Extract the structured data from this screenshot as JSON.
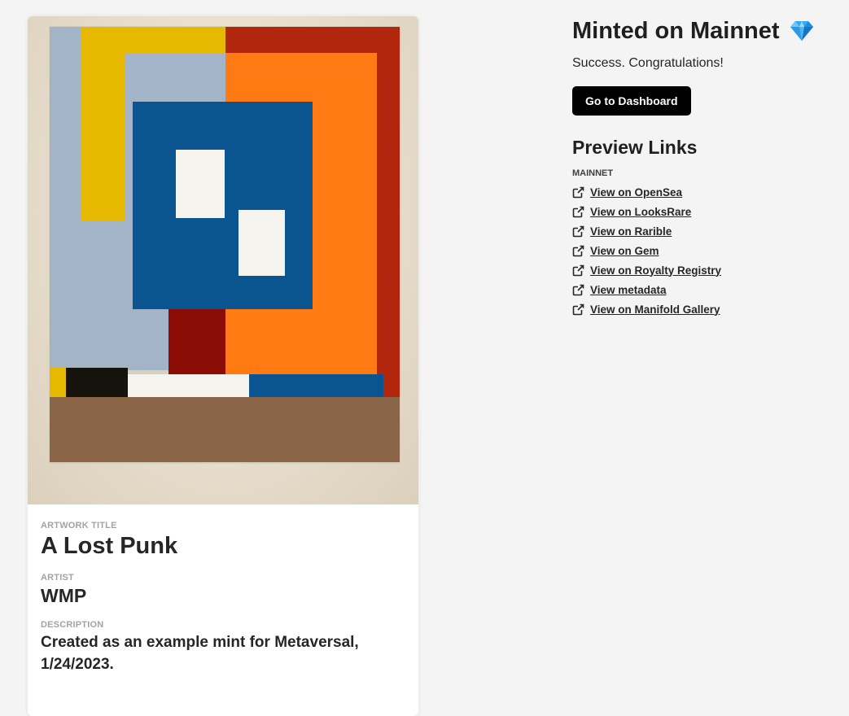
{
  "artwork": {
    "title_label": "ARTWORK TITLE",
    "title": "A Lost Punk",
    "artist_label": "ARTIST",
    "artist": "WMP",
    "description_label": "DESCRIPTION",
    "description": "Created as an example mint for Metaversal, 1/24/2023."
  },
  "status": {
    "title": "Minted on Mainnet",
    "title_icon": "diamond-icon",
    "message": "Success. Congratulations!",
    "dashboard_button": "Go to Dashboard"
  },
  "preview": {
    "title": "Preview Links",
    "network_label": "MAINNET",
    "link_icon": "external-link-icon",
    "links": [
      {
        "label": "View on OpenSea"
      },
      {
        "label": "View on LooksRare"
      },
      {
        "label": "View on Rarible"
      },
      {
        "label": "View on Gem"
      },
      {
        "label": "View on Royalty Registry"
      },
      {
        "label": "View metadata"
      },
      {
        "label": "View on Manifold Gallery"
      }
    ]
  },
  "colors": {
    "page_background": "#f4f4f4",
    "button_background": "#000000",
    "button_text": "#ffffff",
    "label_gray": "#a3a3a3",
    "text_dark": "#262626"
  }
}
